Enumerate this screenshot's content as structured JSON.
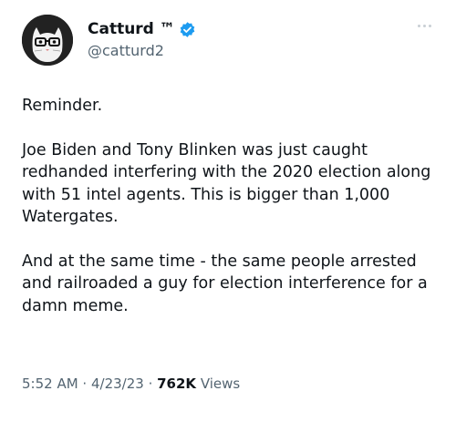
{
  "tweet": {
    "author": {
      "display_name": "Catturd ™",
      "handle": "@catturd2",
      "avatar_icon": "cat-avatar-icon",
      "verified_icon": "verified-badge-icon",
      "verified_color": "#1d9bf0"
    },
    "more_icon": "more-options-icon",
    "paragraphs": [
      "Reminder.",
      "Joe Biden and Tony Blinken was just caught redhanded interfering with the 2020 election along with 51 intel agents. This is bigger than 1,000 Watergates.",
      "And at the same time - the same people arrested and railroaded a guy for election interference for a damn meme."
    ],
    "meta": {
      "time": "5:52 AM",
      "separator1": " · ",
      "date": "4/23/23",
      "separator2": " · ",
      "views_count": "762K",
      "views_label": " Views"
    }
  }
}
